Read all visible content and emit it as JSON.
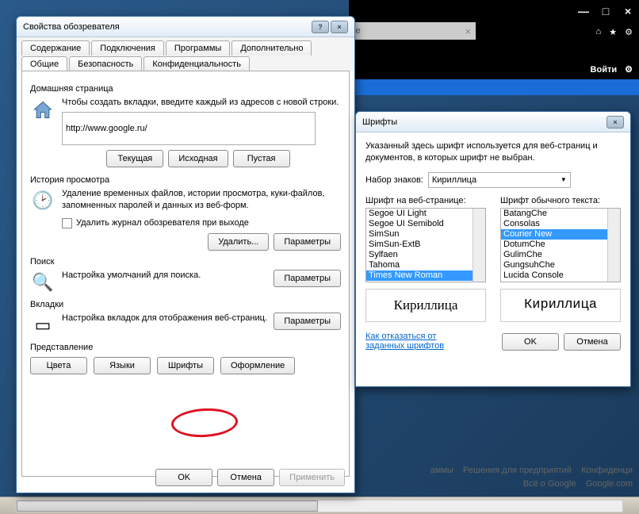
{
  "browser": {
    "tab_fragment": "le",
    "login": "Войти",
    "footer_line1_a": "аммы",
    "footer_line1_b": "Решения для предприятий",
    "footer_line1_c": "Конфиденци",
    "footer_line2_a": "Всё о Google",
    "footer_line2_b": "Google.com"
  },
  "main": {
    "title": "Свойства обозревателя",
    "help": "?",
    "close": "×",
    "tabs_row1": [
      "Содержание",
      "Подключения",
      "Программы",
      "Дополнительно"
    ],
    "tabs_row2": [
      "Общие",
      "Безопасность",
      "Конфиденциальность"
    ],
    "active_tab": "Общие",
    "home": {
      "label": "Домашняя страница",
      "desc": "Чтобы создать вкладки, введите каждый из адресов с новой строки.",
      "value": "http://www.google.ru/",
      "btn_current": "Текущая",
      "btn_default": "Исходная",
      "btn_blank": "Пустая"
    },
    "history": {
      "label": "История просмотра",
      "desc": "Удаление временных файлов, истории просмотра, куки-файлов, запомненных паролей и данных из веб-форм.",
      "cb": "Удалить журнал обозревателя при выходе",
      "btn_delete": "Удалить...",
      "btn_params": "Параметры"
    },
    "search": {
      "label": "Поиск",
      "desc": "Настройка умолчаний для поиска.",
      "btn": "Параметры"
    },
    "tabs_sect": {
      "label": "Вкладки",
      "desc": "Настройка вкладок для отображения веб-страниц.",
      "btn": "Параметры"
    },
    "presentation": {
      "label": "Представление",
      "btn_colors": "Цвета",
      "btn_lang": "Языки",
      "btn_fonts": "Шрифты",
      "btn_style": "Оформление"
    },
    "footer": {
      "ok": "OK",
      "cancel": "Отмена",
      "apply": "Применить"
    }
  },
  "fonts": {
    "title": "Шрифты",
    "close": "×",
    "desc": "Указанный здесь шрифт используется для веб-страниц и документов, в которых шрифт не выбран.",
    "charset_label": "Набор знаков:",
    "charset_value": "Кириллица",
    "web_label": "Шрифт на веб-странице:",
    "plain_label": "Шрифт обычного текста:",
    "web_fonts": [
      "Segoe UI Light",
      "Segoe UI Semibold",
      "SimSun",
      "SimSun-ExtB",
      "Sylfaen",
      "Tahoma",
      "Times New Roman"
    ],
    "web_selected": "Times New Roman",
    "plain_fonts": [
      "BatangChe",
      "Consolas",
      "Courier New",
      "DotumChe",
      "GulimChe",
      "GungsuhChe",
      "Lucida Console"
    ],
    "plain_selected": "Courier New",
    "sample": "Кириллица",
    "link": "Как отказаться от заданных шрифтов",
    "ok": "OK",
    "cancel": "Отмена"
  }
}
